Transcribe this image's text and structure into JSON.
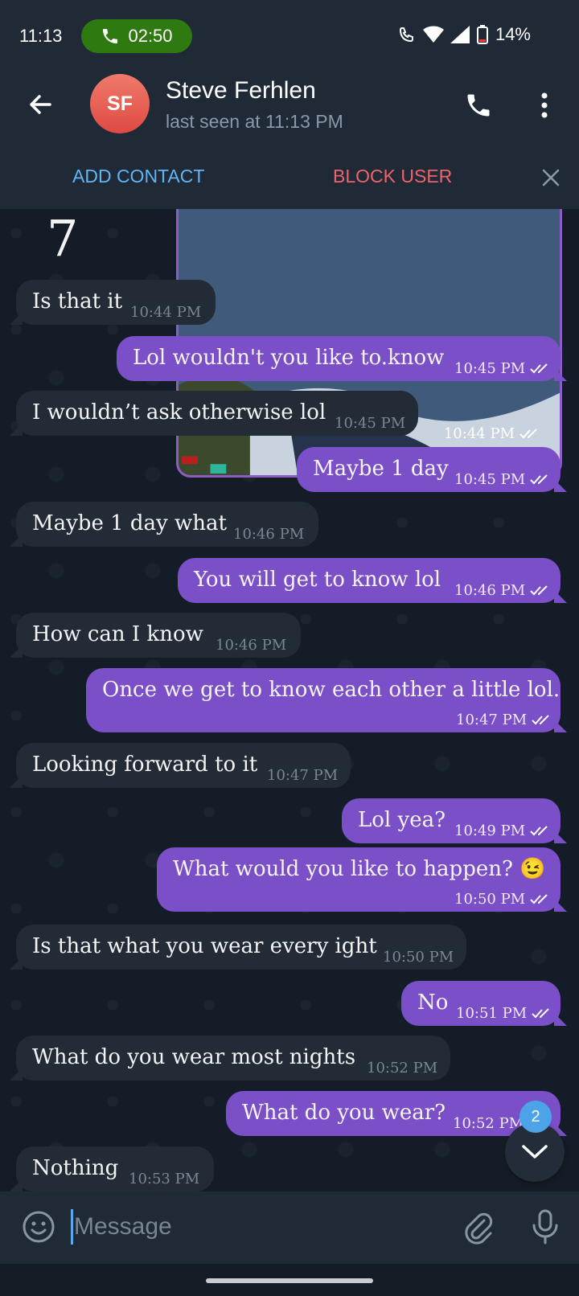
{
  "status_bar": {
    "time": "11:13",
    "call_timer": "02:50",
    "battery": "14%"
  },
  "header": {
    "avatar_initials": "SF",
    "contact_name": "Steve Ferhlen",
    "last_seen": "last seen at 11:13 PM",
    "add_contact_label": "ADD CONTACT",
    "block_user_label": "BLOCK USER"
  },
  "sticker_text": "7",
  "photo_time": "10:44 PM",
  "messages": [
    {
      "dir": "in",
      "text": "Is that it",
      "time": "10:44 PM"
    },
    {
      "dir": "out",
      "text": "Lol wouldn't you like to.know",
      "time": "10:45 PM"
    },
    {
      "dir": "in",
      "text": "I wouldn’t ask otherwise lol",
      "time": "10:45 PM"
    },
    {
      "dir": "out",
      "text": "Maybe 1 day",
      "time": "10:45 PM"
    },
    {
      "dir": "in",
      "text": "Maybe 1 day what",
      "time": "10:46 PM"
    },
    {
      "dir": "out",
      "text": "You will get to know lol",
      "time": "10:46 PM"
    },
    {
      "dir": "in",
      "text": "How can I know",
      "time": "10:46 PM"
    },
    {
      "dir": "out",
      "text": "Once we get to know each other a little lol.",
      "time": "10:47 PM"
    },
    {
      "dir": "in",
      "text": "Looking forward to it",
      "time": "10:47 PM"
    },
    {
      "dir": "out",
      "text": "Lol yea?",
      "time": "10:49 PM"
    },
    {
      "dir": "out",
      "text": "What would you like to happen? 😉",
      "time": "10:50 PM"
    },
    {
      "dir": "in",
      "text": "Is that what you wear every ight",
      "time": "10:50 PM"
    },
    {
      "dir": "out",
      "text": "No",
      "time": "10:51 PM"
    },
    {
      "dir": "in",
      "text": "What do you wear most nights",
      "time": "10:52 PM"
    },
    {
      "dir": "out",
      "text": "What do you wear?",
      "time": "10:52 PM"
    },
    {
      "dir": "in",
      "text": "Nothing",
      "time": "10:53 PM"
    }
  ],
  "unread_count": "2",
  "input": {
    "placeholder": "Message"
  },
  "icons": [
    "phone-icon",
    "back-arrow-icon",
    "more-vert-icon",
    "close-icon",
    "emoji-icon",
    "attach-icon",
    "mic-icon",
    "chevron-down-icon",
    "double-check-icon"
  ]
}
